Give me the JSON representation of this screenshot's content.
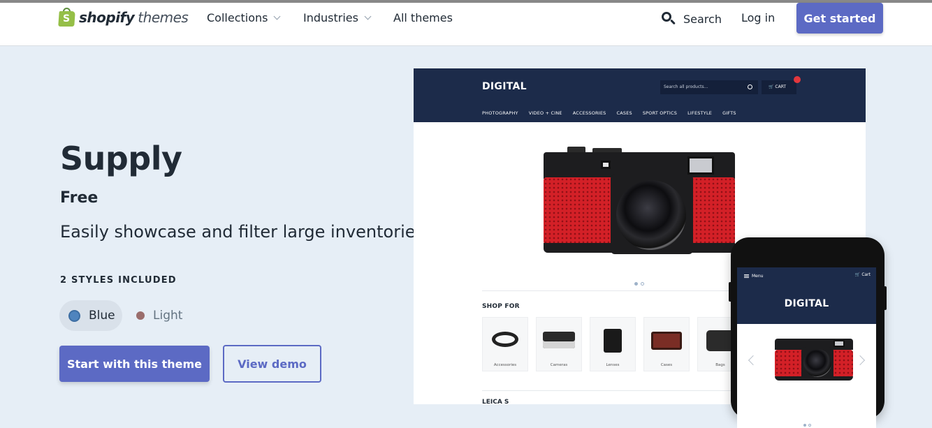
{
  "nav": {
    "logo_brand": "shopify",
    "logo_suffix": "themes",
    "collections": "Collections",
    "industries": "Industries",
    "all_themes": "All themes",
    "search": "Search",
    "login": "Log in",
    "get_started": "Get started"
  },
  "hero": {
    "title": "Supply",
    "price": "Free",
    "tagline": "Easily showcase and filter large inventories",
    "styles_label": "2 STYLES INCLUDED",
    "styles": [
      {
        "label": "Blue",
        "color": "#4f84be",
        "selected": true
      },
      {
        "label": "Light",
        "color": "#9a6d6c",
        "selected": false
      }
    ],
    "start_button": "Start with this theme",
    "demo_button": "View demo"
  },
  "desktop_preview": {
    "logo": "DIGITAL",
    "search_placeholder": "Search all products...",
    "cart": "CART",
    "menu": [
      "PHOTOGRAPHY",
      "VIDEO + CINE",
      "ACCESSORIES",
      "CASES",
      "SPORT OPTICS",
      "LIFESTYLE",
      "GIFTS"
    ],
    "shop_for": "SHOP FOR",
    "categories": [
      "Accessories",
      "Cameras",
      "Lenses",
      "Cases",
      "Bags"
    ],
    "next_heading": "LEICA S"
  },
  "mobile_preview": {
    "menu": "Menu",
    "cart": "Cart",
    "logo": "DIGITAL"
  },
  "colors": {
    "accent": "#5c6ac4",
    "hero_bg": "#e6eef6",
    "preview_header": "#1c2b4a",
    "camera_red": "#d32027"
  }
}
